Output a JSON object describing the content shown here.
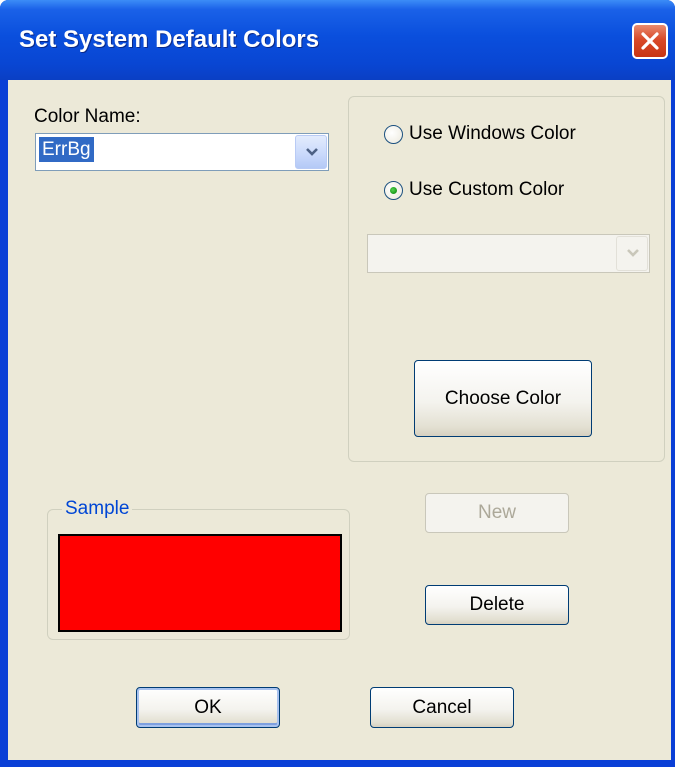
{
  "window": {
    "title": "Set System Default Colors"
  },
  "color_name": {
    "label": "Color Name:",
    "value": "ErrBg"
  },
  "color_source": {
    "options": [
      {
        "label": "Use Windows Color",
        "checked": false
      },
      {
        "label": "Use Custom Color",
        "checked": true
      }
    ],
    "custom_color_select_value": "",
    "choose_color_label": "Choose Color"
  },
  "sample": {
    "legend": "Sample",
    "color": "#ff0000"
  },
  "buttons": {
    "new_label": "New",
    "delete_label": "Delete",
    "ok_label": "OK",
    "cancel_label": "Cancel"
  },
  "icons": {
    "close": "close-icon",
    "dropdown": "chevron-down-icon"
  },
  "colors": {
    "titlebar": "#0a4fdd",
    "dialog_bg": "#ece9d8",
    "selection": "#316ac5",
    "group_legend": "#0046d5"
  }
}
